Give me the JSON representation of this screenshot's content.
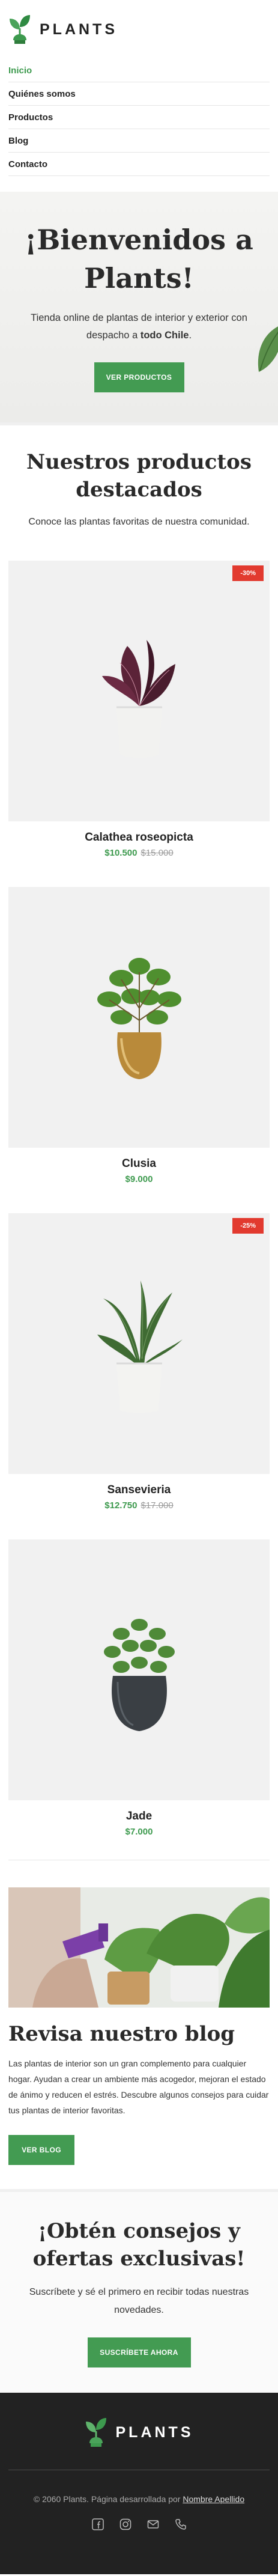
{
  "brand": {
    "name": "PLANTS"
  },
  "nav": {
    "items": [
      {
        "label": "Inicio",
        "active": true
      },
      {
        "label": "Quiénes somos"
      },
      {
        "label": "Productos"
      },
      {
        "label": "Blog"
      },
      {
        "label": "Contacto"
      }
    ]
  },
  "hero": {
    "title": "¡Bienvenidos a Plants!",
    "subtitle_pre": "Tienda online de plantas de interior y exterior con despacho a ",
    "subtitle_bold": "todo Chile",
    "subtitle_post": ".",
    "button": "VER PRODUCTOS"
  },
  "featured": {
    "title": "Nuestros productos destacados",
    "subtitle": "Conoce las plantas favoritas de nuestra comunidad."
  },
  "products": [
    {
      "name": "Calathea roseopicta",
      "price": "$10.500",
      "old_price": "$15.000",
      "badge": "-30%",
      "plant": "calathea"
    },
    {
      "name": "Clusia",
      "price": "$9.000",
      "old_price": "",
      "badge": "",
      "plant": "clusia"
    },
    {
      "name": "Sansevieria",
      "price": "$12.750",
      "old_price": "$17.000",
      "badge": "-25%",
      "plant": "sansevieria"
    },
    {
      "name": "Jade",
      "price": "$7.000",
      "old_price": "",
      "badge": "",
      "plant": "jade"
    }
  ],
  "blog": {
    "title": "Revisa nuestro blog",
    "text": "Las plantas de interior son un gran complemento para cualquier hogar. Ayudan a crear un ambiente más acogedor, mejoran el estado de ánimo y reducen el estrés. Descubre algunos consejos para cuidar tus plantas de interior favoritas.",
    "button": "VER BLOG"
  },
  "newsletter": {
    "title": "¡Obtén consejos y ofertas exclusivas!",
    "text": "Suscríbete y sé el primero en recibir todas nuestras novedades.",
    "button": "SUSCRÍBETE AHORA"
  },
  "footer": {
    "copyright_pre": "© 2060 Plants. Página desarrollada por ",
    "copyright_link": "Nombre Apellido",
    "socials": [
      "facebook-icon",
      "instagram-icon",
      "mail-icon",
      "phone-icon"
    ]
  },
  "colors": {
    "accent": "#439b52",
    "badge": "#e23a2f",
    "footer_bg": "#222222"
  }
}
